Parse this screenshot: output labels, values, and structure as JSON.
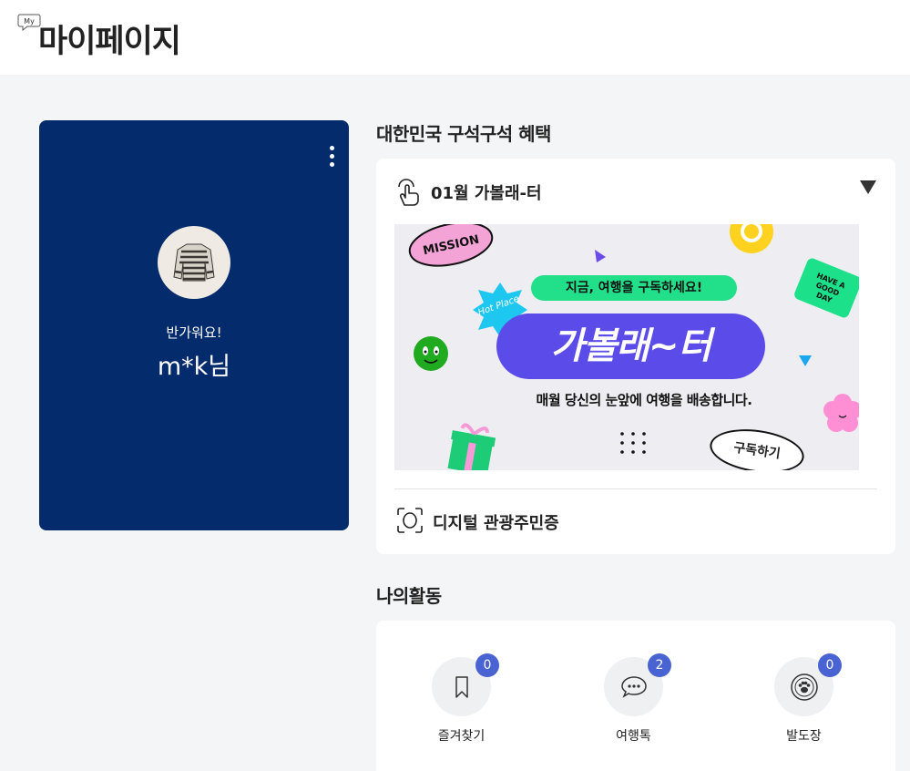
{
  "header": {
    "badge": "My",
    "title": "마이페이지"
  },
  "profile": {
    "greeting": "반가워요!",
    "nickname": "m*k님"
  },
  "benefit": {
    "section_title": "대한민국 구석구석 혜택",
    "subscription_title": "01월 가볼래-터",
    "banner": {
      "sticker_mission": "MISSION",
      "sticker_hot_place": "Hot Place",
      "sticker_have_a_good_day": "HAVE A GOOD DAY",
      "slogan": "지금, 여행을 구독하세요!",
      "brand": "가볼래~터",
      "description": "매월 당신의 눈앞에 여행을 배송합니다.",
      "cta": "구독하기"
    },
    "digital_label": "디지털 관광주민증"
  },
  "activity": {
    "section_title": "나의활동",
    "items": [
      {
        "label": "즐겨찾기",
        "count": "0",
        "icon": "bookmark-icon"
      },
      {
        "label": "여행톡",
        "count": "2",
        "icon": "chat-bubble-icon"
      },
      {
        "label": "발도장",
        "count": "0",
        "icon": "paw-stamp-icon"
      }
    ]
  },
  "colors": {
    "profile_bg": "#042b6b",
    "badge_bg": "#4a63d3",
    "page_bg": "#f4f5f7",
    "banner_brand": "#5b4be8",
    "banner_green": "#22e08a"
  }
}
